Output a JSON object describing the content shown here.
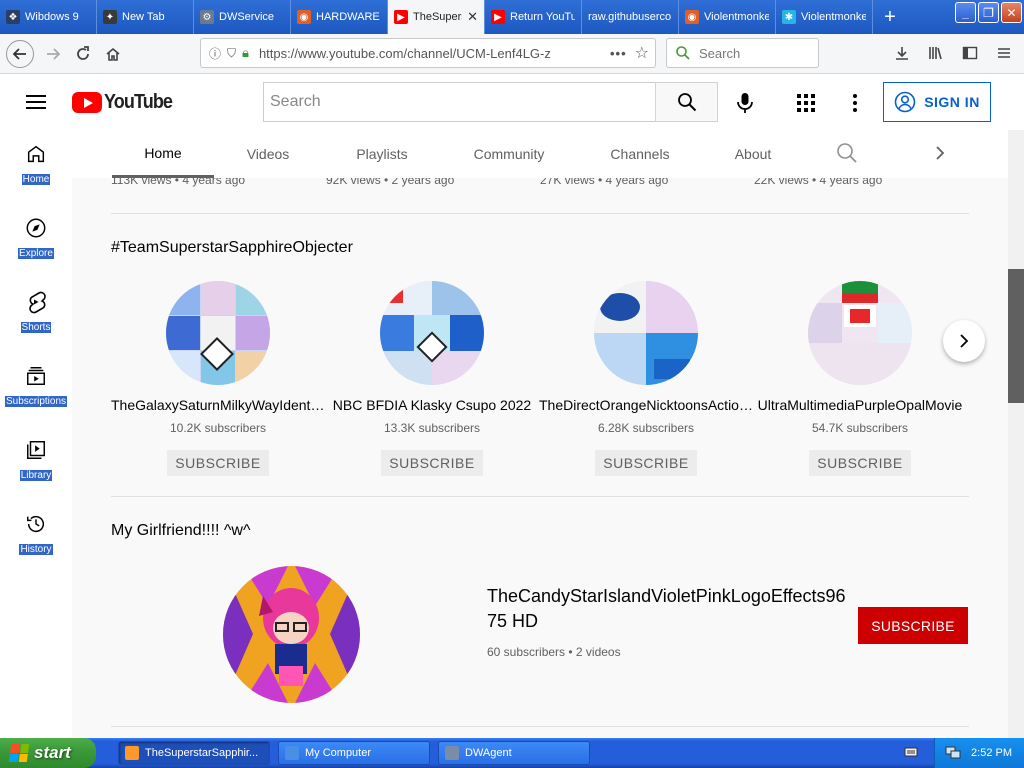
{
  "browser": {
    "tabs": [
      {
        "label": "Wibdows 9",
        "fav_color": "#2b3f66",
        "fav_glyph": "❖"
      },
      {
        "label": "New Tab",
        "fav_color": "#3a3a3a",
        "fav_glyph": "✦"
      },
      {
        "label": "DWService",
        "fav_color": "#6b7a8f",
        "fav_glyph": "⚙"
      },
      {
        "label": "HARDWARE",
        "fav_color": "#e0602a",
        "fav_glyph": "◉"
      },
      {
        "label": "TheSuperstar",
        "fav_color": "#ff0000",
        "fav_glyph": "▶",
        "active": true
      },
      {
        "label": "Return YouTube",
        "fav_color": "#ff0000",
        "fav_glyph": "▶"
      },
      {
        "label": "raw.githubuserco",
        "fav_color": "",
        "fav_glyph": ""
      },
      {
        "label": "Violentmonkey",
        "fav_color": "#e0602a",
        "fav_glyph": "◉"
      },
      {
        "label": "Violentmonkey",
        "fav_color": "#28b5e6",
        "fav_glyph": "✱"
      }
    ],
    "new_tab_glyph": "+",
    "window_controls": {
      "minimize": "_",
      "restore": "❐",
      "close": "✕"
    },
    "url": "https://www.youtube.com/channel/UCM-Lenf4LG-z",
    "search_placeholder": "Search"
  },
  "youtube": {
    "logo_text": "YouTube",
    "search_placeholder": "Search",
    "sign_in_label": "SIGN IN",
    "guide": [
      {
        "label": "Home",
        "icon": "home-icon"
      },
      {
        "label": "Explore",
        "icon": "compass-icon"
      },
      {
        "label": "Shorts",
        "icon": "shorts-icon"
      },
      {
        "label": "Subscriptions",
        "icon": "subscriptions-icon"
      },
      {
        "label": "Library",
        "icon": "library-icon"
      },
      {
        "label": "History",
        "icon": "history-icon"
      }
    ],
    "channel_tabs": [
      "Home",
      "Videos",
      "Playlists",
      "Community",
      "Channels",
      "About"
    ],
    "top_views": [
      "113K views • 4 years ago",
      "92K views • 2 years ago",
      "27K views • 4 years ago",
      "22K views • 4 years ago"
    ],
    "section1": {
      "title": "#TeamSuperstarSapphireObjecter",
      "channels": [
        {
          "name": "TheGalaxySaturnMilkyWayIdents HD",
          "subscribers": "10.2K subscribers",
          "button": "SUBSCRIBE"
        },
        {
          "name": "NBC BFDIA Klasky Csupo 2022",
          "subscribers": "13.3K subscribers",
          "button": "SUBSCRIBE"
        },
        {
          "name": "TheDirectOrangeNicktoonsActionCo",
          "subscribers": "6.28K subscribers",
          "button": "SUBSCRIBE"
        },
        {
          "name": "UltraMultimediaPurpleOpalMovie",
          "subscribers": "54.7K subscribers",
          "button": "SUBSCRIBE"
        }
      ]
    },
    "section2": {
      "title": "My Girlfriend!!!! ^w^",
      "channel_name": "TheCandyStarIslandVioletPinkLogoEffects9675 HD",
      "meta": "60 subscribers • 2 videos",
      "button": "SUBSCRIBE"
    }
  },
  "taskbar": {
    "start_label": "start",
    "tasks": [
      {
        "label": "TheSuperstarSapphir...",
        "active": true
      },
      {
        "label": "My Computer",
        "active": false
      },
      {
        "label": "DWAgent",
        "active": false
      }
    ],
    "clock": "2:52 PM"
  }
}
